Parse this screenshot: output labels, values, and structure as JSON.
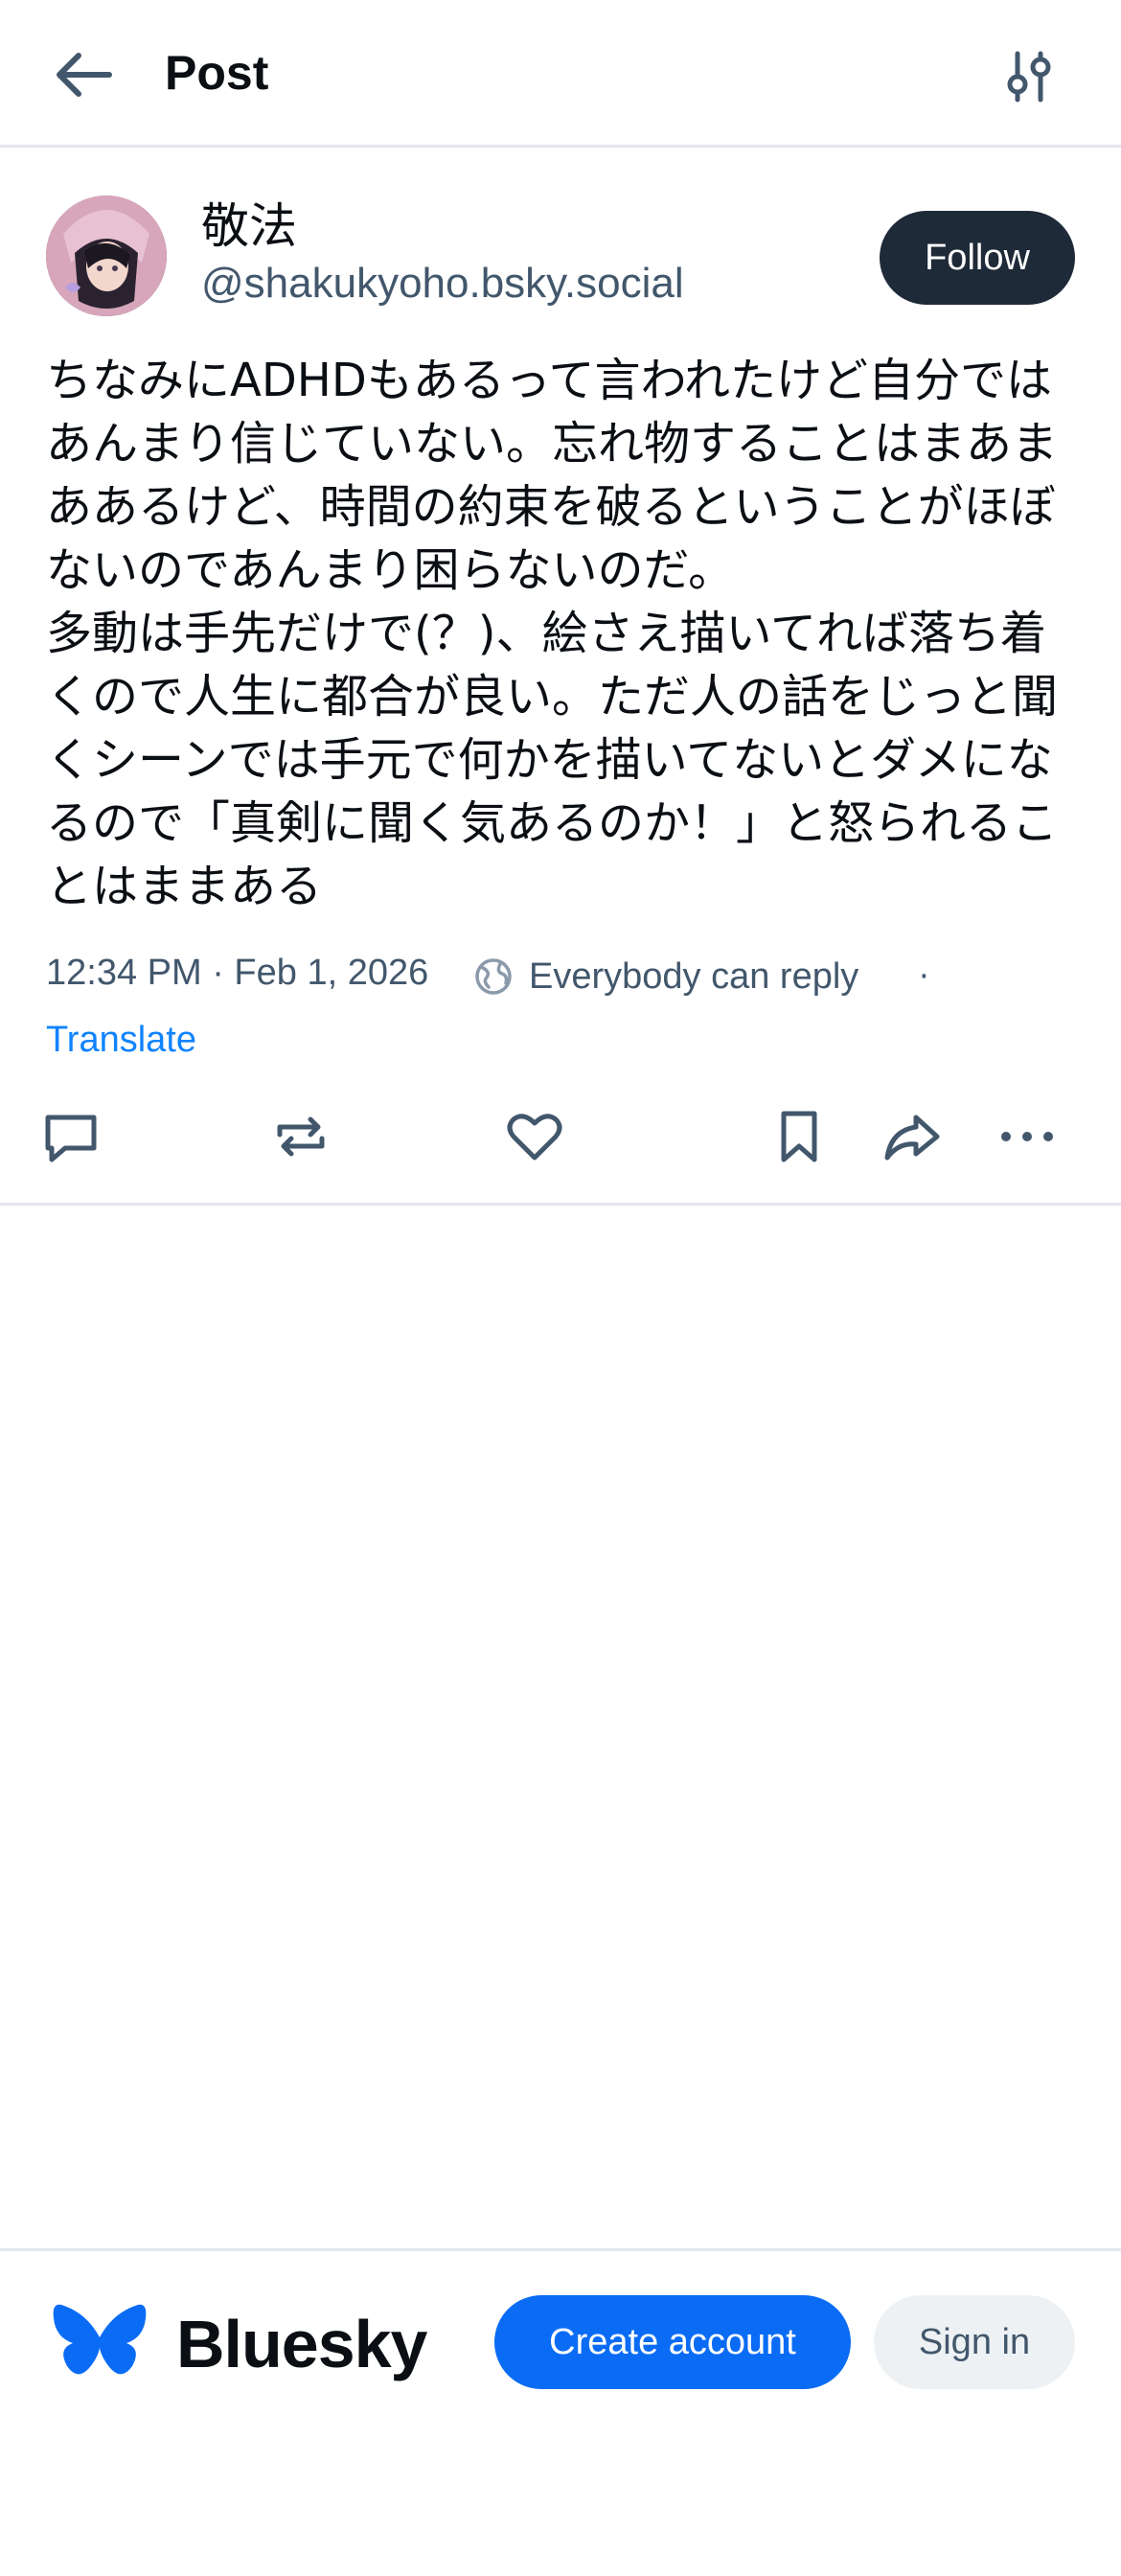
{
  "header": {
    "title": "Post",
    "back_icon": "arrow-left-icon",
    "filter_icon": "sliders-icon"
  },
  "post": {
    "author": {
      "display_name": "敬法",
      "handle": "@shakukyoho.bsky.social"
    },
    "follow_label": "Follow",
    "text": "ちなみにADHDもあるって言われたけど自分ではあんまり信じていない。忘れ物することはまあまああるけど、時間の約束を破るということがほぼないのであんまり困らないのだ。\n多動は手先だけで(？)、絵さえ描いてれば落ち着くので人生に都合が良い。ただ人の話をじっと聞くシーンでは手元で何かを描いてないとダメになるので「真剣に聞く気あるのか！」と怒られることはままある",
    "timestamp": "12:34 PM · Feb 1, 2026",
    "reply_setting": "Everybody can reply",
    "separator": "·",
    "translate_label": "Translate",
    "actions": [
      "reply-icon",
      "repost-icon",
      "like-icon",
      "bookmark-icon",
      "share-icon",
      "more-icon"
    ]
  },
  "footer": {
    "brand": "Bluesky",
    "create_account_label": "Create account",
    "sign_in_label": "Sign in"
  },
  "colors": {
    "accent": "#0a6cf5",
    "link": "#1083fe",
    "follow_bg": "#1f2a38",
    "muted_text": "#42576c",
    "divider": "#e3e7ec"
  }
}
